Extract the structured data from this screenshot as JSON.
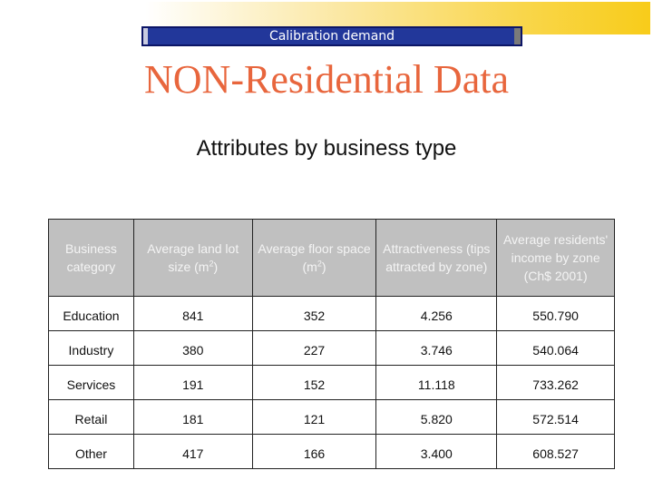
{
  "banner": {
    "text": "Calibration demand"
  },
  "title": "NON-Residential Data",
  "subtitle": "Attributes by business type",
  "table": {
    "headers": [
      {
        "text": "Business category",
        "sup": ""
      },
      {
        "text": "Average land lot size (m",
        "sup": "2",
        "after": ")"
      },
      {
        "text": "Average floor space (m",
        "sup": "2",
        "after": ")"
      },
      {
        "text": "Attractiveness (tips attracted by zone)",
        "sup": ""
      },
      {
        "text": "Average residents' income by zone (Ch$ 2001)",
        "sup": ""
      }
    ],
    "rows": [
      [
        "Education",
        "841",
        "352",
        "4.256",
        "550.790"
      ],
      [
        "Industry",
        "380",
        "227",
        "3.746",
        "540.064"
      ],
      [
        "Services",
        "191",
        "152",
        "11.118",
        "733.262"
      ],
      [
        "Retail",
        "181",
        "121",
        "5.820",
        "572.514"
      ],
      [
        "Other",
        "417",
        "166",
        "3.400",
        "608.527"
      ]
    ]
  },
  "colors": {
    "banner_bg": "#22379a",
    "title": "#e8663d",
    "header_bg": "#c0c0c0",
    "header_text": "#f4f4f4",
    "accent_yellow": "#f8cc1a"
  }
}
